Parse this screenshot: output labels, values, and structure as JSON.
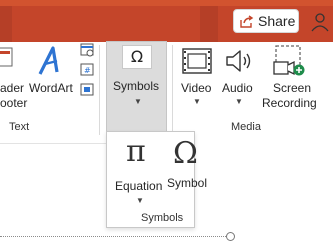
{
  "colors": {
    "titlebar": "#c4452a",
    "accent_red": "#c4452a",
    "symbols_bg": "#dcdcdc",
    "wordart_blue": "#2e74d2",
    "screen_green": "#1f8c4b"
  },
  "header": {
    "share_label": "Share"
  },
  "ribbon": {
    "header_footer": {
      "line1": "ader",
      "line2": "ooter",
      "icon": "header-footer-icon"
    },
    "wordart": {
      "label": "WordArt",
      "icon": "wordart-icon"
    },
    "symbols": {
      "glyph": "Ω",
      "label": "Symbols",
      "icon": "omega-icon"
    },
    "video": {
      "label": "Video",
      "icon": "film-icon"
    },
    "audio": {
      "label": "Audio",
      "icon": "speaker-icon"
    },
    "screen_recording": {
      "line1": "Screen",
      "line2": "Recording",
      "icon": "screen-recording-icon"
    },
    "groups": {
      "text": "Text",
      "media": "Media"
    }
  },
  "symbols_menu": {
    "equation": {
      "glyph": "π",
      "label": "Equation"
    },
    "symbol": {
      "glyph": "Ω",
      "label": "Symbol"
    },
    "group_label": "Symbols"
  }
}
